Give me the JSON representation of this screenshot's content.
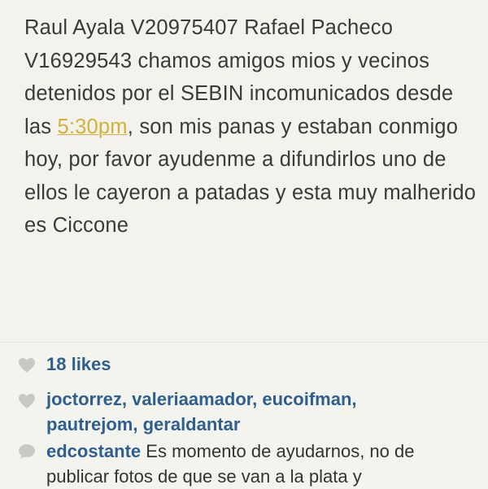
{
  "post": {
    "text_part1": "Raul Ayala V20975407 Rafael Pacheco V16929543 chamos amigos mios y vecinos detenidos por el SEBIN incomunicados desde las ",
    "time_link": "5:30pm",
    "text_part2": ", son mis panas y estaban conmigo hoy, por favor ayudenme a difundirlos uno de ellos le cayeron a patadas y esta muy malherido es Ciccone"
  },
  "likes": {
    "count_label": "18 likes",
    "icon": "heart-icon"
  },
  "likers": {
    "icon": "heart-icon",
    "users": [
      "joctorrez",
      "valeriaamador",
      "eucoifman",
      "pautrejom",
      "geraldantar"
    ]
  },
  "comment": {
    "icon": "comment-bubble-icon",
    "user": "edcostante",
    "text": "Es momento de ayudarnos, no de publicar fotos de que se van a la plata y"
  },
  "colors": {
    "link": "#2f5f8f",
    "highlight": "#d4b13a",
    "background": "#f4f4ef"
  }
}
